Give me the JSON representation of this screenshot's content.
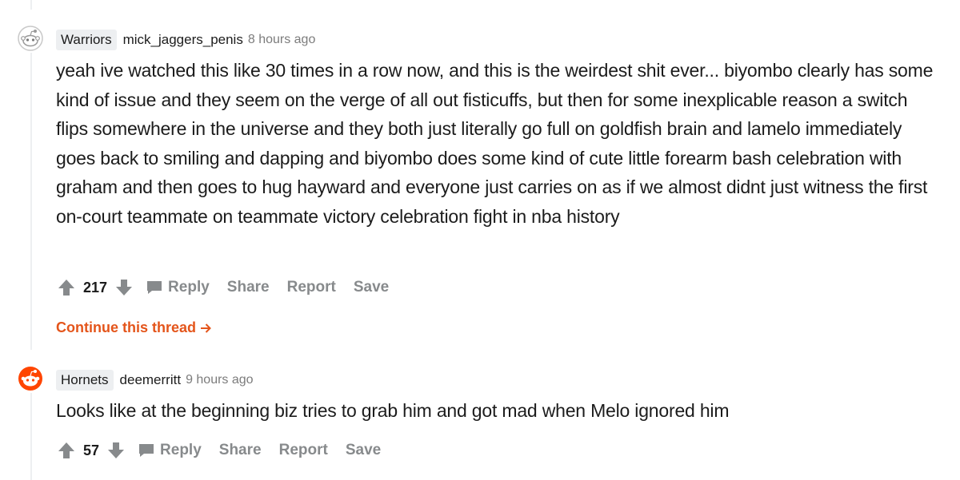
{
  "comments": [
    {
      "flair": "Warriors",
      "author": "mick_jaggers_penis",
      "time": "8 hours ago",
      "body": "yeah ive watched this like 30 times in a row now, and this is the weirdest shit ever... biyombo clearly has some kind of issue and they seem on the verge of all out fisticuffs, but then for some inexplicable reason a switch flips somewhere in the universe and they both just literally go full on goldfish brain and lamelo immediately goes back to smiling and dapping and biyombo does some kind of cute little forearm bash celebration with graham and then goes to hug hayward and everyone just carries on as if we almost didnt just witness the first on-court teammate on teammate victory celebration fight in nba history",
      "votes": "217",
      "reply_label": "Reply",
      "share_label": "Share",
      "report_label": "Report",
      "save_label": "Save",
      "continue_label": "Continue this thread"
    },
    {
      "flair": "Hornets",
      "author": "deemerritt",
      "time": "9 hours ago",
      "body": "Looks like at the beginning biz tries to grab him and got mad when Melo ignored him",
      "votes": "57",
      "reply_label": "Reply",
      "share_label": "Share",
      "report_label": "Report",
      "save_label": "Save"
    }
  ],
  "colors": {
    "accent": "#e4551b",
    "muted": "#878a8c",
    "text": "#1c1c1c",
    "flair_bg": "#edeff1"
  }
}
